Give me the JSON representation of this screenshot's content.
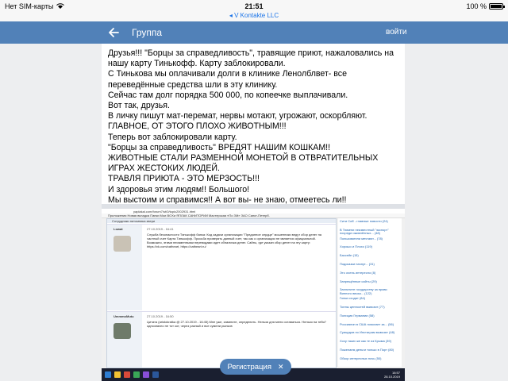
{
  "status_bar": {
    "carrier": "Нет SIM-карты",
    "time": "21:51",
    "app_back": "◂ V Kontakte LLC",
    "battery": "100 %"
  },
  "header": {
    "title": "Группа",
    "login": "войти"
  },
  "post": {
    "lines": [
      "Друзья!!! \"Борцы за справедливость\", травящие приют, нажаловались на нашу карту Тинькофф. Карту заблокировали.",
      "С Тинькова мы оплачивали долги в клинике Ленолблвет- все переведённые средства шли в эту клинику.",
      "Сейчас там долг порядка 500 000, по копеечке выплачивали.",
      "Вот так, друзья.",
      "В личку пишут мат-перемат, нервы мотают, угрожают, оскорбляют.",
      "ГЛАВНОЕ, ОТ ЭТОГО ПЛОХО ЖИВОТНЫМ!!!",
      "Теперь вот заблокировали карту.",
      "\"Борцы за справедливость\" ВРЕДЯТ НАШИМ КОШКАМ!!",
      "ЖИВОТНЫЕ СТАЛИ РАЗМЕННОЙ МОНЕТОЙ В ОТВРАТИТЕЛЬНЫХ ИГРАХ ЖЕСТОКИХ ЛЮДЕЙ.",
      "ТРАВЛЯ ПРИЮТА - ЭТО МЕРЗОСТЬ!!!",
      "И здоровья этим людям!! Большого!",
      "Мы выстоим и справимся!! А вот вы- не знаю, отмеетесь ли!!"
    ]
  },
  "screenshot": {
    "address": "yaplakal.com/forum7/st/0/topic2002931.html",
    "bookmarks": "Приложения   Новая вкладка   Папки Мои BOXи   ЯПЛАК   САНИТОРИИ   Мастерская «По ЗМ»   ЗАО Санкт-Петерб.",
    "forum_header": "Сотрудники питомника звери",
    "posts": [
      {
        "user": "Lowat",
        "meta": "27.10.2019 - 16:41",
        "body": "Служба безопасности Тинькофф банка: Код задачи организации \"Преданное сердце\" мошенники ведут сбор денег на частный счет Карта Тинькофф. Просьба проверять данный счет, так как о организации не является официальной. Возможно, этими неизменными переводами идет обналичка денег. Сайты, где указан сбор денег на эту карту: https://vk.com/catheart, https://catheart.ru/"
      },
      {
        "user": "UmmmoMutu",
        "meta": "27.10.2019 - 16:50",
        "body": "Цитата (aristokratka @ 27.10.2019 - 16:45) Мне уже, извините, определить. Нельзя для меня оставаться. Нельзя на тебя?  однозначно не тот кот, через разный и все сумели рынков"
      }
    ],
    "sidebar": [
      "Сити Сиб - главные новости (24)",
      "В Тюмени неизвестный \"экспорт\" посреди оживлённых... (48)",
      "Пользователи мечтают... (78)",
      "Хорошо и Плохо (119)",
      "Бассейн (15)",
      "Подсказки начнут... (31)",
      "Это очень интересно (8)",
      "Запрещённые сайты (29)",
      "Заплатите государству за право Винного ввоза... (122)",
      "Гонки сходят (84)",
      "Тонны ценностей вывозят (77)",
      "Полиция Германии (58)",
      "Россиянин в США помогает за... (56)",
      "Суицидов по Инстаграм вывозят (48)",
      "Хочу таких же как те из Крыма (39)",
      "Пожелаем деньги только в Порт (80)",
      "Обзор интересных ночь (50)"
    ],
    "clock": "16:57\n28.10.2019"
  },
  "register_button": {
    "label": "Регистрация",
    "close": "✕"
  }
}
